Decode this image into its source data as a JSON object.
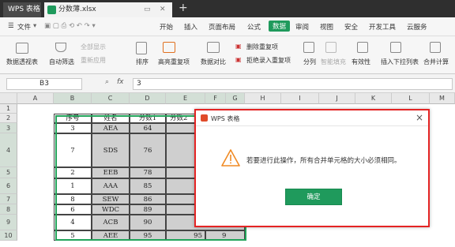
{
  "app": {
    "title": "WPS 表格",
    "file_tab": "分数薄.xlsx"
  },
  "menu": {
    "items": [
      "文件",
      "开始",
      "插入",
      "页面布局",
      "公式",
      "数据",
      "审阅",
      "视图",
      "安全",
      "开发工具",
      "云服务"
    ],
    "active": "数据"
  },
  "ribbon": {
    "pivot": "数据透视表",
    "autofilter": "自动筛选",
    "show_all": "全部显示",
    "reapply": "重新应用",
    "sort": "排序",
    "highlight_dup": "高亮重复项",
    "compare": "数据对比",
    "remove_dup": "删除重复项",
    "reject_dup": "拒绝录入重复项",
    "split": "分列",
    "smart_fill": "智能填充",
    "validity": "有效性",
    "dropdown": "插入下拉列表",
    "merge_calc": "合并计算"
  },
  "formula_bar": {
    "name_box": "B3",
    "fx": "fx",
    "value": "3"
  },
  "columns": [
    "A",
    "B",
    "C",
    "D",
    "E",
    "F",
    "G",
    "H",
    "I",
    "J",
    "K",
    "L",
    "M"
  ],
  "rows": [
    "1",
    "2",
    "3",
    "4",
    "5",
    "6",
    "7",
    "8",
    "9",
    "10"
  ],
  "table": {
    "headers": [
      "序号",
      "姓名",
      "分数1",
      "分数2"
    ],
    "rows": [
      [
        "3",
        "AEA",
        "64"
      ],
      [
        "7",
        "SDS",
        "76"
      ],
      [
        "2",
        "EEB",
        "78"
      ],
      [
        "1",
        "AAA",
        "85"
      ],
      [
        "8",
        "SEW",
        "86"
      ],
      [
        "6",
        "WDC",
        "89"
      ],
      [
        "4",
        "ACB",
        "90"
      ],
      [
        "5",
        "AEE",
        "95",
        "95",
        "9"
      ]
    ]
  },
  "dialog": {
    "title": "WPS 表格",
    "message": "若要进行此操作，所有合并单元格的大小必须相同。",
    "ok": "确定"
  }
}
